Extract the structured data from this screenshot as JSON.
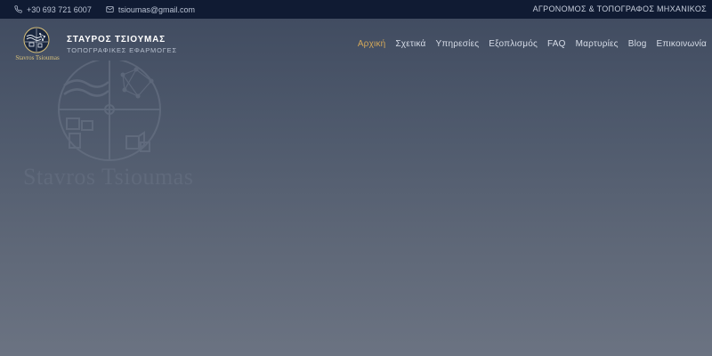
{
  "topbar": {
    "phone": "+30 693 721 6007",
    "email": "tsioumas@gmail.com",
    "tagline": "ΑΓΡΟΝΟΜΟΣ & ΤΟΠΟΓΡΑΦΟΣ ΜΗΧΑΝΙΚΟΣ",
    "phone_icon": "phone-icon",
    "email_icon": "envelope-icon"
  },
  "logo": {
    "script": "Stavros Tsioumas",
    "accent_color": "#d8c07a"
  },
  "brand": {
    "name": "ΣΤΑΥΡΟΣ ΤΣΙΟΥΜΑΣ",
    "subtitle": "ΤΟΠΟΓΡΑΦΙΚΕΣ ΕΦΑΡΜΟΓΕΣ"
  },
  "nav": {
    "items": [
      {
        "label": "Αρχική",
        "active": true
      },
      {
        "label": "Σχετικά"
      },
      {
        "label": "Υπηρεσίες"
      },
      {
        "label": "Εξοπλισμός"
      },
      {
        "label": "FAQ"
      },
      {
        "label": "Μαρτυρίες"
      },
      {
        "label": "Blog"
      },
      {
        "label": "Επικοινωνία"
      }
    ],
    "active_color": "#d3a85a"
  },
  "hero": {
    "watermark_text": "Stavros Tsioumas"
  }
}
